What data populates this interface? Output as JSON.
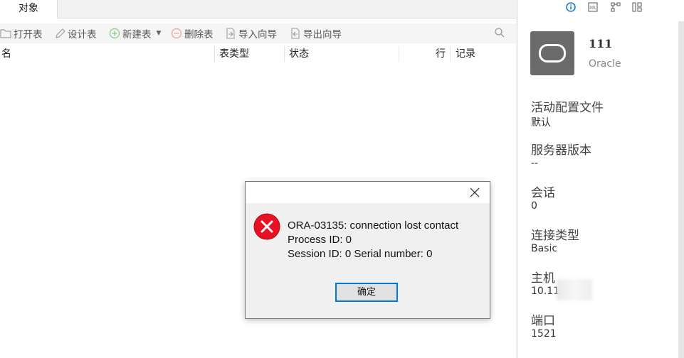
{
  "tabs": [
    {
      "label": "对象",
      "active": true
    }
  ],
  "toolbar": {
    "open_table": "打开表",
    "design_table": "设计表",
    "new_table": "新建表",
    "delete_table": "删除表",
    "import_wizard": "导入向导",
    "export_wizard": "导出向导",
    "icon_color": "#9e9e9e"
  },
  "columns": [
    "名",
    "表类型",
    "状态",
    "行",
    "记录"
  ],
  "right_panel": {
    "connection_name": "111",
    "connection_type": "Oracle",
    "top_icons": [
      "info-icon",
      "ddl-icon",
      "er-diagram-icon",
      "layout-icon"
    ],
    "props": [
      {
        "label": "活动配置文件",
        "value": "默认"
      },
      {
        "label": "服务器版本",
        "value": "--"
      },
      {
        "label": "会话",
        "value": "0"
      },
      {
        "label": "连接类型",
        "value": "Basic"
      },
      {
        "label": "主机",
        "value": "10.11"
      },
      {
        "label": "端口",
        "value": "1521"
      }
    ],
    "accent_color": "#1a7fd8"
  },
  "dialog": {
    "line1": "ORA-03135: connection lost contact",
    "line2": "Process ID: 0",
    "line3": "Session ID: 0 Serial number: 0",
    "ok_label": "确定",
    "error_color": "#e81123"
  }
}
